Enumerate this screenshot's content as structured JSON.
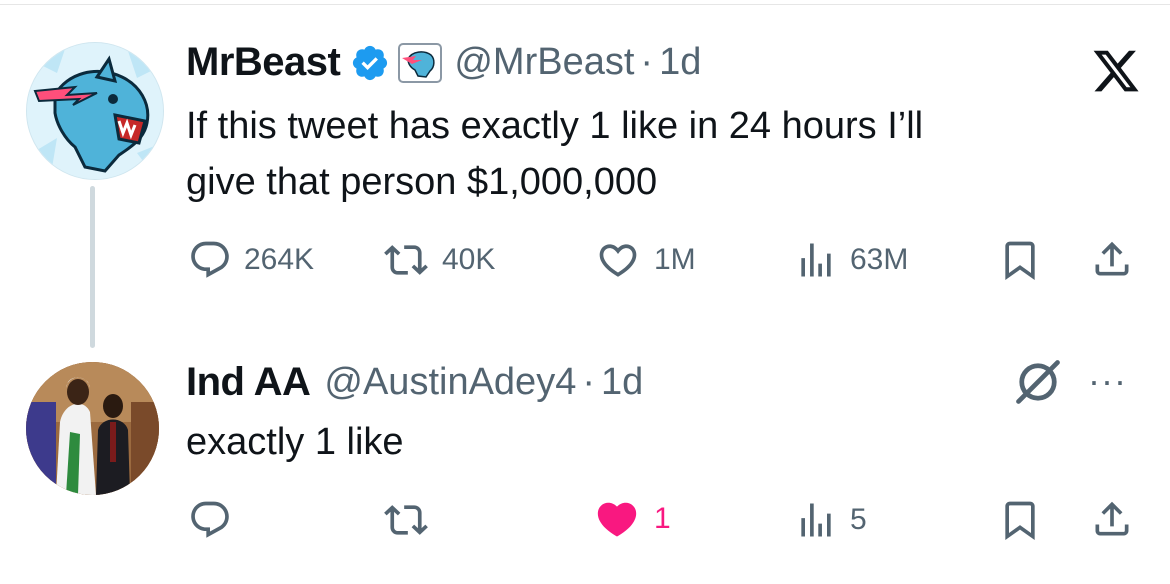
{
  "colors": {
    "verified": "#1d9bf0",
    "like_active": "#f91880",
    "muted": "#536471",
    "text": "#0f1419"
  },
  "tweets": [
    {
      "name": "MrBeast",
      "verified": true,
      "affiliate_badge": "mrbeast-panther-icon",
      "handle": "@MrBeast",
      "separator": "·",
      "time": "1d",
      "text_lines": [
        "If this tweet has exactly 1 like in 24 hours I’ll",
        "give that person $1,000,000"
      ],
      "replies": "264K",
      "reposts": "40K",
      "likes": "1M",
      "views": "63M",
      "liked": false
    },
    {
      "name": "Ind AA",
      "handle": "@AustinAdey4",
      "separator": "·",
      "time": "1d",
      "text_lines": [
        "exactly 1 like"
      ],
      "replies": "",
      "reposts": "",
      "likes": "1",
      "views": "5",
      "liked": true
    }
  ],
  "icons": {
    "logo": "x-logo-icon",
    "grok": "grok-icon",
    "more": "more-options-icon",
    "more_glyph": "···"
  }
}
